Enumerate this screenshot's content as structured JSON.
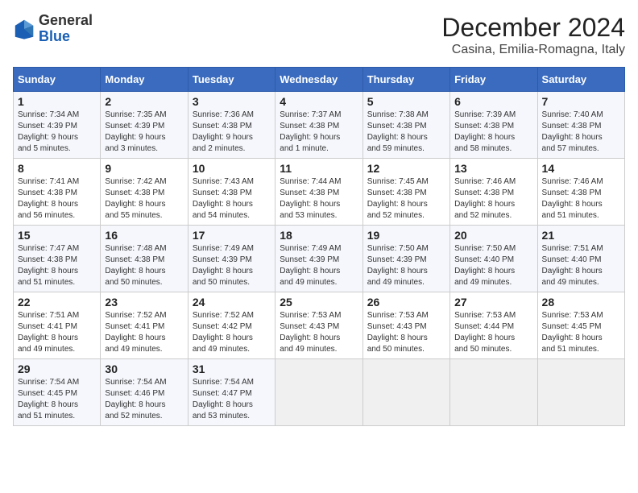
{
  "logo": {
    "general": "General",
    "blue": "Blue"
  },
  "title": "December 2024",
  "subtitle": "Casina, Emilia-Romagna, Italy",
  "days_header": [
    "Sunday",
    "Monday",
    "Tuesday",
    "Wednesday",
    "Thursday",
    "Friday",
    "Saturday"
  ],
  "weeks": [
    [
      {
        "num": "1",
        "info": "Sunrise: 7:34 AM\nSunset: 4:39 PM\nDaylight: 9 hours\nand 5 minutes."
      },
      {
        "num": "2",
        "info": "Sunrise: 7:35 AM\nSunset: 4:39 PM\nDaylight: 9 hours\nand 3 minutes."
      },
      {
        "num": "3",
        "info": "Sunrise: 7:36 AM\nSunset: 4:38 PM\nDaylight: 9 hours\nand 2 minutes."
      },
      {
        "num": "4",
        "info": "Sunrise: 7:37 AM\nSunset: 4:38 PM\nDaylight: 9 hours\nand 1 minute."
      },
      {
        "num": "5",
        "info": "Sunrise: 7:38 AM\nSunset: 4:38 PM\nDaylight: 8 hours\nand 59 minutes."
      },
      {
        "num": "6",
        "info": "Sunrise: 7:39 AM\nSunset: 4:38 PM\nDaylight: 8 hours\nand 58 minutes."
      },
      {
        "num": "7",
        "info": "Sunrise: 7:40 AM\nSunset: 4:38 PM\nDaylight: 8 hours\nand 57 minutes."
      }
    ],
    [
      {
        "num": "8",
        "info": "Sunrise: 7:41 AM\nSunset: 4:38 PM\nDaylight: 8 hours\nand 56 minutes."
      },
      {
        "num": "9",
        "info": "Sunrise: 7:42 AM\nSunset: 4:38 PM\nDaylight: 8 hours\nand 55 minutes."
      },
      {
        "num": "10",
        "info": "Sunrise: 7:43 AM\nSunset: 4:38 PM\nDaylight: 8 hours\nand 54 minutes."
      },
      {
        "num": "11",
        "info": "Sunrise: 7:44 AM\nSunset: 4:38 PM\nDaylight: 8 hours\nand 53 minutes."
      },
      {
        "num": "12",
        "info": "Sunrise: 7:45 AM\nSunset: 4:38 PM\nDaylight: 8 hours\nand 52 minutes."
      },
      {
        "num": "13",
        "info": "Sunrise: 7:46 AM\nSunset: 4:38 PM\nDaylight: 8 hours\nand 52 minutes."
      },
      {
        "num": "14",
        "info": "Sunrise: 7:46 AM\nSunset: 4:38 PM\nDaylight: 8 hours\nand 51 minutes."
      }
    ],
    [
      {
        "num": "15",
        "info": "Sunrise: 7:47 AM\nSunset: 4:38 PM\nDaylight: 8 hours\nand 51 minutes."
      },
      {
        "num": "16",
        "info": "Sunrise: 7:48 AM\nSunset: 4:38 PM\nDaylight: 8 hours\nand 50 minutes."
      },
      {
        "num": "17",
        "info": "Sunrise: 7:49 AM\nSunset: 4:39 PM\nDaylight: 8 hours\nand 50 minutes."
      },
      {
        "num": "18",
        "info": "Sunrise: 7:49 AM\nSunset: 4:39 PM\nDaylight: 8 hours\nand 49 minutes."
      },
      {
        "num": "19",
        "info": "Sunrise: 7:50 AM\nSunset: 4:39 PM\nDaylight: 8 hours\nand 49 minutes."
      },
      {
        "num": "20",
        "info": "Sunrise: 7:50 AM\nSunset: 4:40 PM\nDaylight: 8 hours\nand 49 minutes."
      },
      {
        "num": "21",
        "info": "Sunrise: 7:51 AM\nSunset: 4:40 PM\nDaylight: 8 hours\nand 49 minutes."
      }
    ],
    [
      {
        "num": "22",
        "info": "Sunrise: 7:51 AM\nSunset: 4:41 PM\nDaylight: 8 hours\nand 49 minutes."
      },
      {
        "num": "23",
        "info": "Sunrise: 7:52 AM\nSunset: 4:41 PM\nDaylight: 8 hours\nand 49 minutes."
      },
      {
        "num": "24",
        "info": "Sunrise: 7:52 AM\nSunset: 4:42 PM\nDaylight: 8 hours\nand 49 minutes."
      },
      {
        "num": "25",
        "info": "Sunrise: 7:53 AM\nSunset: 4:43 PM\nDaylight: 8 hours\nand 49 minutes."
      },
      {
        "num": "26",
        "info": "Sunrise: 7:53 AM\nSunset: 4:43 PM\nDaylight: 8 hours\nand 50 minutes."
      },
      {
        "num": "27",
        "info": "Sunrise: 7:53 AM\nSunset: 4:44 PM\nDaylight: 8 hours\nand 50 minutes."
      },
      {
        "num": "28",
        "info": "Sunrise: 7:53 AM\nSunset: 4:45 PM\nDaylight: 8 hours\nand 51 minutes."
      }
    ],
    [
      {
        "num": "29",
        "info": "Sunrise: 7:54 AM\nSunset: 4:45 PM\nDaylight: 8 hours\nand 51 minutes."
      },
      {
        "num": "30",
        "info": "Sunrise: 7:54 AM\nSunset: 4:46 PM\nDaylight: 8 hours\nand 52 minutes."
      },
      {
        "num": "31",
        "info": "Sunrise: 7:54 AM\nSunset: 4:47 PM\nDaylight: 8 hours\nand 53 minutes."
      },
      null,
      null,
      null,
      null
    ]
  ]
}
